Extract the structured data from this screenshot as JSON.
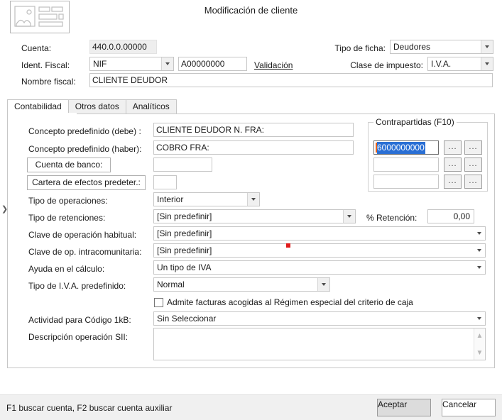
{
  "window": {
    "title": "Modificación de cliente",
    "logo_icon": "image-placeholder-icon"
  },
  "header": {
    "cuenta_label": "Cuenta:",
    "cuenta_value": "440.0.0.00000",
    "ident_fiscal_label": "Ident. Fiscal:",
    "ident_fiscal_type": "NIF",
    "ident_fiscal_number": "A00000000",
    "validacion_link": "Validación",
    "nombre_fiscal_label": "Nombre fiscal:",
    "nombre_fiscal_value": "CLIENTE DEUDOR",
    "tipo_ficha_label": "Tipo de ficha:",
    "tipo_ficha_value": "Deudores",
    "clase_impuesto_label": "Clase de impuesto:",
    "clase_impuesto_value": "I.V.A."
  },
  "tabs": [
    {
      "label": "Contabilidad",
      "active": true
    },
    {
      "label": "Otros datos",
      "active": false
    },
    {
      "label": "Analíticos",
      "active": false
    }
  ],
  "contabilidad": {
    "concepto_debe_label": "Concepto predefinido (debe) :",
    "concepto_debe_value": "CLIENTE DEUDOR N. FRA:",
    "concepto_haber_label": "Concepto predefinido (haber):",
    "concepto_haber_value": "COBRO FRA:",
    "cuenta_banco_button": "Cuenta de banco:",
    "cuenta_banco_value": "",
    "cartera_efectos_button": "Cartera de efectos predeter.:",
    "cartera_efectos_value": "",
    "tipo_operaciones_label": "Tipo de operaciones:",
    "tipo_operaciones_value": "Interior",
    "tipo_retenciones_label": "Tipo de retenciones:",
    "tipo_retenciones_value": "[Sin predefinir]",
    "retencion_label": "% Retención:",
    "retencion_value": "0,00",
    "clave_operacion_label": "Clave de operación habitual:",
    "clave_operacion_value": "[Sin predefinir]",
    "clave_intracom_label": "Clave de op. intracomunitaria:",
    "clave_intracom_value": "[Sin predefinir]",
    "ayuda_calculo_label": "Ayuda en el cálculo:",
    "ayuda_calculo_value": "Un tipo de IVA",
    "tipo_iva_label": "Tipo de I.V.A. predefinido:",
    "tipo_iva_value": "Normal",
    "criterio_caja_label": "Admite facturas acogidas al Régimen especial del criterio de caja",
    "criterio_caja_checked": false,
    "actividad_label": "Actividad para Código 1kB:",
    "actividad_value": "Sin Seleccionar",
    "descripcion_sii_label": "Descripción operación SII:",
    "descripcion_sii_value": ""
  },
  "contrapartidas": {
    "title": "Contrapartidas (F10)",
    "rows": [
      {
        "value": "6000000000",
        "selected": true,
        "btn1": "...",
        "btn2": "..."
      },
      {
        "value": "",
        "selected": false,
        "btn1": "...",
        "btn2": "..."
      },
      {
        "value": "",
        "selected": false,
        "btn1": "...",
        "btn2": "..."
      }
    ]
  },
  "footer": {
    "status": "F1 buscar cuenta, F2 buscar cuenta auxiliar",
    "accept_label": "Aceptar",
    "cancel_label": "Cancelar"
  },
  "colors": {
    "selection_blue": "#2a6fd4",
    "caret_orange": "#e8631a",
    "marker_red": "#e01b1b"
  }
}
